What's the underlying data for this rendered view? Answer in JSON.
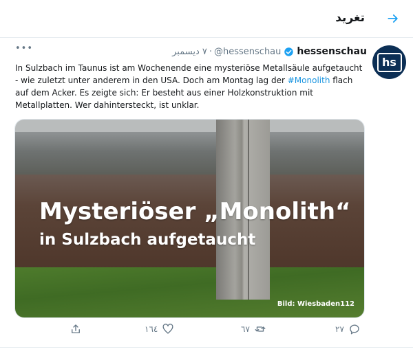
{
  "header": {
    "title": "تغريد",
    "back_icon": "arrow-right-icon",
    "accent": "#1da1f2"
  },
  "tweet": {
    "author_name": "hessenschau",
    "handle": "@hessenschau",
    "separator": "·",
    "date": "٧ ديسمبر",
    "avatar_text": "hs",
    "more_label": "•••",
    "text_part1": "In Sulzbach im Taunus ist am Wochenende eine mysteriöse Metallsäule aufgetaucht - wie zuletzt unter anderem in den USA. Doch am Montag lag der ",
    "hashtag": "#Monolith",
    "text_part2": " flach auf dem Acker. Es zeigte sich: Er besteht aus einer Holzkonstruktion mit Metallplatten. Wer dahintersteckt, ist unklar.",
    "hashtag_color": "#1b95e0"
  },
  "media": {
    "headline": "Mysteriöser „Monolith“",
    "subline": "in Sulzbach aufgetaucht",
    "credit": "Bild: Wiesbaden112"
  },
  "actions": {
    "reply_count": "٢٧",
    "retweet_count": "٦٧",
    "like_count": "١٦٤",
    "reply_icon": "reply-icon",
    "retweet_icon": "retweet-icon",
    "like_icon": "heart-icon",
    "share_icon": "share-icon"
  }
}
